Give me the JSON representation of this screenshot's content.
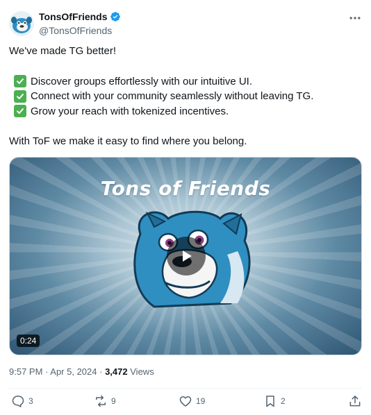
{
  "author": {
    "display_name": "TonsOfFriends",
    "handle": "@TonsOfFriends",
    "verified_icon": "verified-badge-icon",
    "avatar_icon": "pug-mascot-avatar"
  },
  "more_icon": "more-options-icon",
  "tweet": {
    "line1": "We've made TG better!",
    "checks": [
      "Discover groups effortlessly with our intuitive UI.",
      "Connect with your community seamlessly without leaving TG.",
      "Grow your reach with tokenized incentives."
    ],
    "line_last": "With ToF we make it easy to find where you belong."
  },
  "media": {
    "title": "Tons of Friends",
    "duration": "0:24",
    "play_icon": "play-icon"
  },
  "meta": {
    "time": "9:57 PM",
    "date": "Apr 5, 2024",
    "views_count": "3,472",
    "views_label": "Views"
  },
  "actions": {
    "replies": "3",
    "reposts": "9",
    "likes": "19",
    "bookmarks": "2"
  },
  "colors": {
    "accent": "#1d9bf0",
    "text_secondary": "#536471",
    "check_green": "#4caf50",
    "mascot_blue": "#2f8fc1"
  }
}
